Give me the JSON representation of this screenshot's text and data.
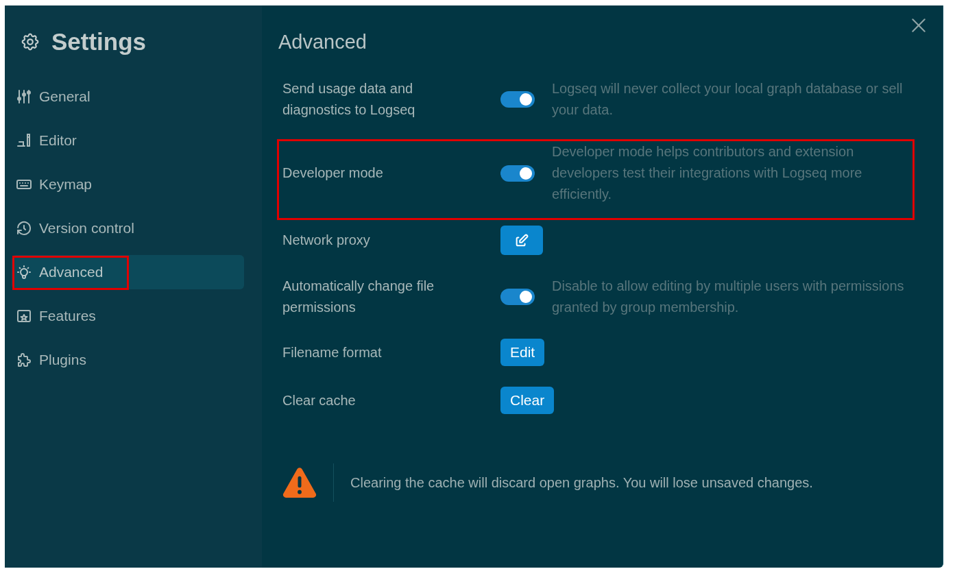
{
  "sidebar": {
    "title": "Settings",
    "items": [
      {
        "label": "General",
        "selected": false,
        "highlighted": false
      },
      {
        "label": "Editor",
        "selected": false,
        "highlighted": false
      },
      {
        "label": "Keymap",
        "selected": false,
        "highlighted": false
      },
      {
        "label": "Version control",
        "selected": false,
        "highlighted": false
      },
      {
        "label": "Advanced",
        "selected": true,
        "highlighted": true
      },
      {
        "label": "Features",
        "selected": false,
        "highlighted": false
      },
      {
        "label": "Plugins",
        "selected": false,
        "highlighted": false
      }
    ]
  },
  "main": {
    "title": "Advanced",
    "settings": [
      {
        "kind": "toggle",
        "label": "Send usage data and diagnostics to Logseq",
        "on": true,
        "description": "Logseq will never collect your local graph database or sell your data.",
        "highlighted": false
      },
      {
        "kind": "toggle",
        "label": "Developer mode",
        "on": true,
        "description": "Developer mode helps contributors and extension developers test their integrations with Logseq more efficiently.",
        "highlighted": true
      },
      {
        "kind": "icon-button",
        "label": "Network proxy",
        "highlighted": false
      },
      {
        "kind": "toggle",
        "label": "Automatically change file permissions",
        "on": true,
        "description": "Disable to allow editing by multiple users with permissions granted by group membership.",
        "highlighted": false
      },
      {
        "kind": "button",
        "label": "Filename format",
        "button": "Edit",
        "highlighted": false
      },
      {
        "kind": "button",
        "label": "Clear cache",
        "button": "Clear",
        "highlighted": false
      }
    ],
    "warning": "Clearing the cache will discard open graphs. You will lose unsaved changes."
  }
}
